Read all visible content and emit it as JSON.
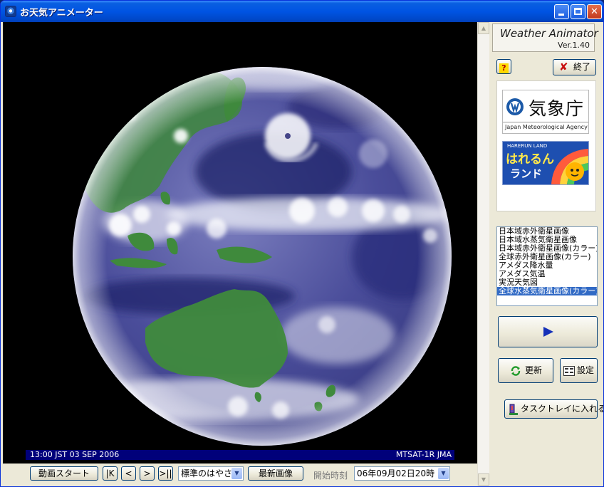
{
  "window": {
    "title": "お天気アニメーター",
    "controls": {
      "minimize": "_",
      "maximize": "□",
      "close": "✕"
    }
  },
  "viewer": {
    "timestamp": "13:00 JST 03 SEP 2006",
    "source": "MTSAT-1R JMA"
  },
  "toolbar": {
    "start_animation": "動画スタート",
    "first_frame": "|K",
    "prev_frame": "<",
    "next_frame": ">",
    "last_frame": ">||",
    "speed": "標準のはやさ",
    "latest_image": "最新画像",
    "start_time_label": "開始時刻",
    "start_time_value": "06年09月02日20時"
  },
  "panel": {
    "app_name": "Weather Animator",
    "version": "Ver.1.40",
    "help": "?",
    "exit_label": "終了",
    "jma_kanji": "気象庁",
    "jma_english": "Japan Meteorological Agency",
    "hareru_small": "HARERUN LAND",
    "hareru_big": "はれるん",
    "hareru_land": "ランド",
    "update_label": "更新",
    "settings_label": "設定",
    "tray_label": "タスクトレイに入れる"
  },
  "image_list": {
    "items": [
      "日本域赤外衛星画像",
      "日本域水蒸気衛星画像",
      "日本域赤外衛星画像(カラー)",
      "全球赤外衛星画像(カラー)",
      "アメダス降水量",
      "アメダス気温",
      "実況天気図",
      "全球水蒸気衛星画像(カラー)"
    ],
    "selected_index": 7
  },
  "colors": {
    "titlebar": "#0054e3",
    "selection": "#316ac5",
    "info_bar": "#00007a",
    "land": "#3f8a3c",
    "water_vapor": "#3c3f8c"
  }
}
